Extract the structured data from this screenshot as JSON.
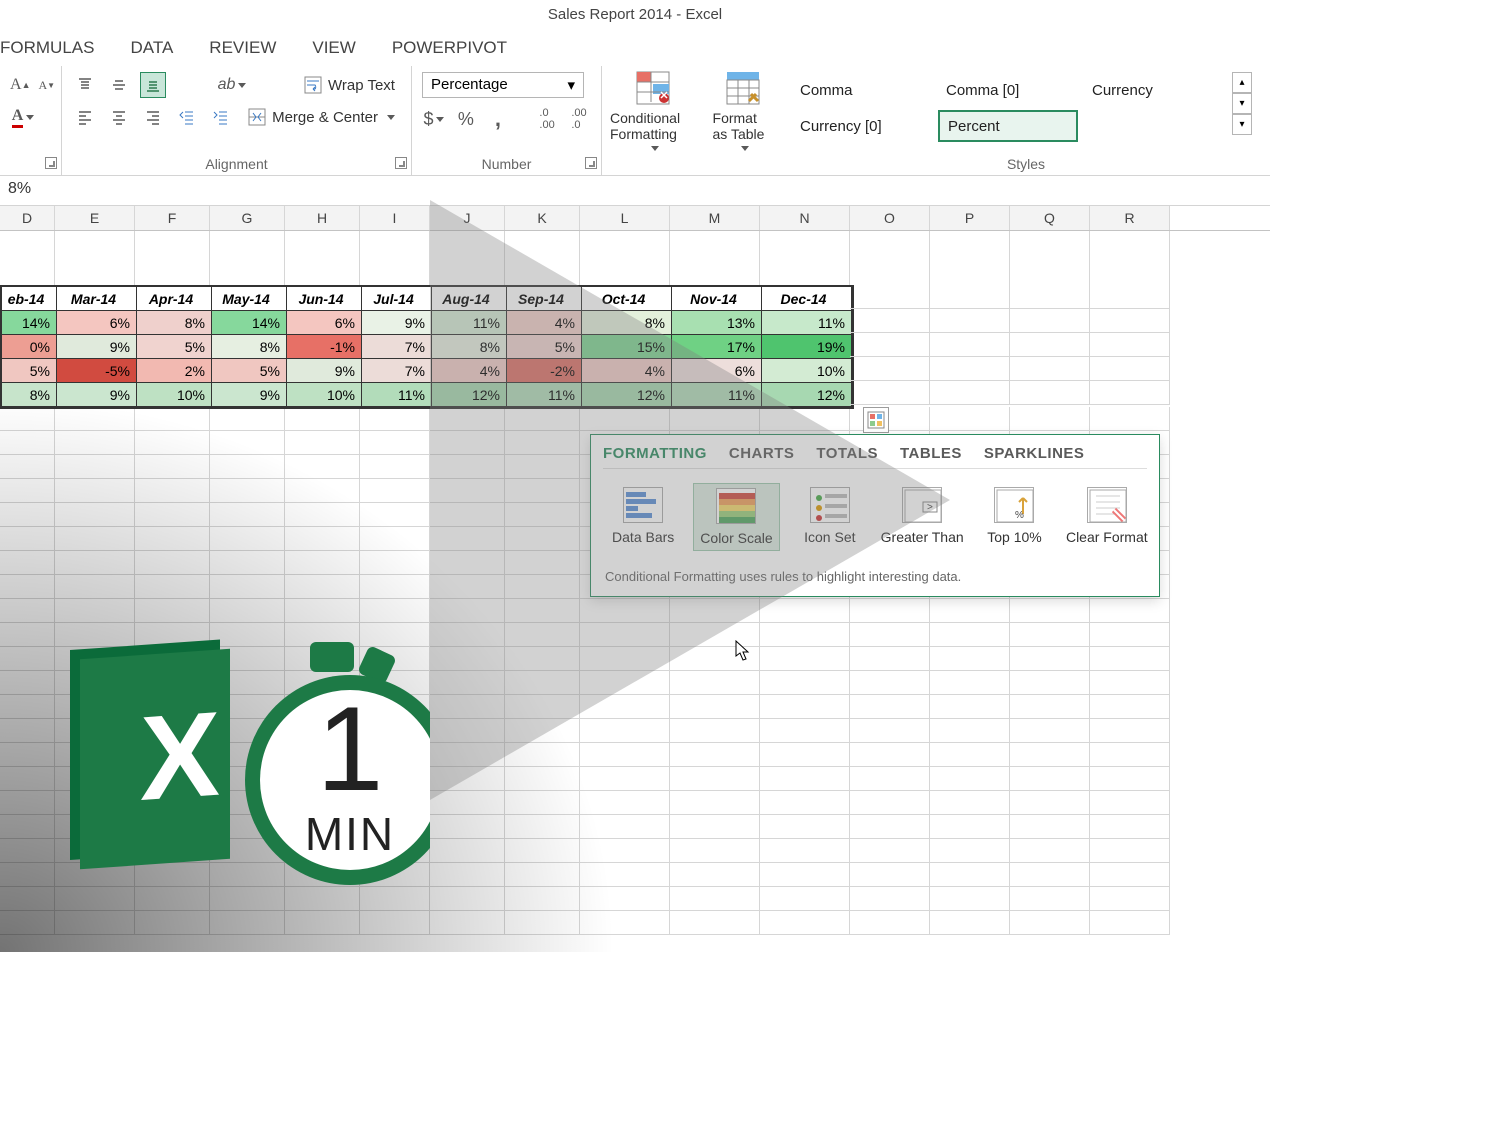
{
  "title": "Sales Report 2014 - Excel",
  "ribbonTabs": [
    "FORMULAS",
    "DATA",
    "REVIEW",
    "VIEW",
    "POWERPIVOT"
  ],
  "alignment": {
    "wrap": "Wrap Text",
    "merge": "Merge & Center",
    "label": "Alignment"
  },
  "number": {
    "format": "Percentage",
    "label": "Number"
  },
  "condFmt": "Conditional Formatting",
  "fmtTable": "Format as Table",
  "styles": {
    "a": "Comma",
    "b": "Comma [0]",
    "c": "Currency",
    "d": "Currency [0]",
    "e": "Percent",
    "label": "Styles"
  },
  "formula": "8%",
  "cols": [
    "D",
    "E",
    "F",
    "G",
    "H",
    "I",
    "J",
    "K",
    "L",
    "M",
    "N",
    "O",
    "P",
    "Q",
    "R"
  ],
  "widths": [
    55,
    80,
    75,
    75,
    75,
    70,
    75,
    75,
    90,
    90,
    90,
    80,
    80,
    80,
    80
  ],
  "months": [
    "eb-14",
    "Mar-14",
    "Apr-14",
    "May-14",
    "Jun-14",
    "Jul-14",
    "Aug-14",
    "Sep-14",
    "Oct-14",
    "Nov-14",
    "Dec-14"
  ],
  "data": [
    [
      "14%",
      "6%",
      "8%",
      "14%",
      "6%",
      "9%",
      "11%",
      "4%",
      "8%",
      "13%",
      "11%"
    ],
    [
      "0%",
      "9%",
      "5%",
      "8%",
      "-1%",
      "7%",
      "8%",
      "5%",
      "15%",
      "17%",
      "19%"
    ],
    [
      "5%",
      "-5%",
      "2%",
      "5%",
      "9%",
      "7%",
      "4%",
      "-2%",
      "4%",
      "6%",
      "10%"
    ],
    [
      "8%",
      "9%",
      "10%",
      "9%",
      "10%",
      "11%",
      "12%",
      "11%",
      "12%",
      "11%",
      "12%"
    ]
  ],
  "cellColors": [
    [
      "#86d89c",
      "#f4c6c0",
      "#efd0cc",
      "#86d89c",
      "#f4c6c0",
      "#e9f2e6",
      "#d6ebd6",
      "#f1cfc9",
      "#e3f0db",
      "#a8e0b1",
      "#c7e9cb"
    ],
    [
      "#ed9e93",
      "#e0eadc",
      "#f0d3cf",
      "#e6efe1",
      "#e77066",
      "#ecdcd8",
      "#e6efe1",
      "#f0d3cf",
      "#7fd693",
      "#6fd184",
      "#4fc46e"
    ],
    [
      "#f0c7c1",
      "#d14b40",
      "#f2b9b1",
      "#f0c7c1",
      "#e0eadc",
      "#ecdcd8",
      "#f1cdc8",
      "#dd7268",
      "#f1cdc8",
      "#eddedb",
      "#d3ebd3"
    ],
    [
      "#c7e4cb",
      "#cbe6cf",
      "#bee1c3",
      "#cbe6cf",
      "#bee1c3",
      "#b2dcba",
      "#a7d8b1",
      "#b2dcba",
      "#a7d8b1",
      "#b2dcba",
      "#a7d8b1"
    ]
  ],
  "qa": {
    "tabs": [
      "FORMATTING",
      "CHARTS",
      "TOTALS",
      "TABLES",
      "SPARKLINES"
    ],
    "items": [
      "Data Bars",
      "Color Scale",
      "Icon Set",
      "Greater Than",
      "Top 10%",
      "Clear Format"
    ],
    "foot": "Conditional Formatting uses rules to highlight interesting data."
  },
  "badge": {
    "big": "1",
    "small": "MIN"
  }
}
